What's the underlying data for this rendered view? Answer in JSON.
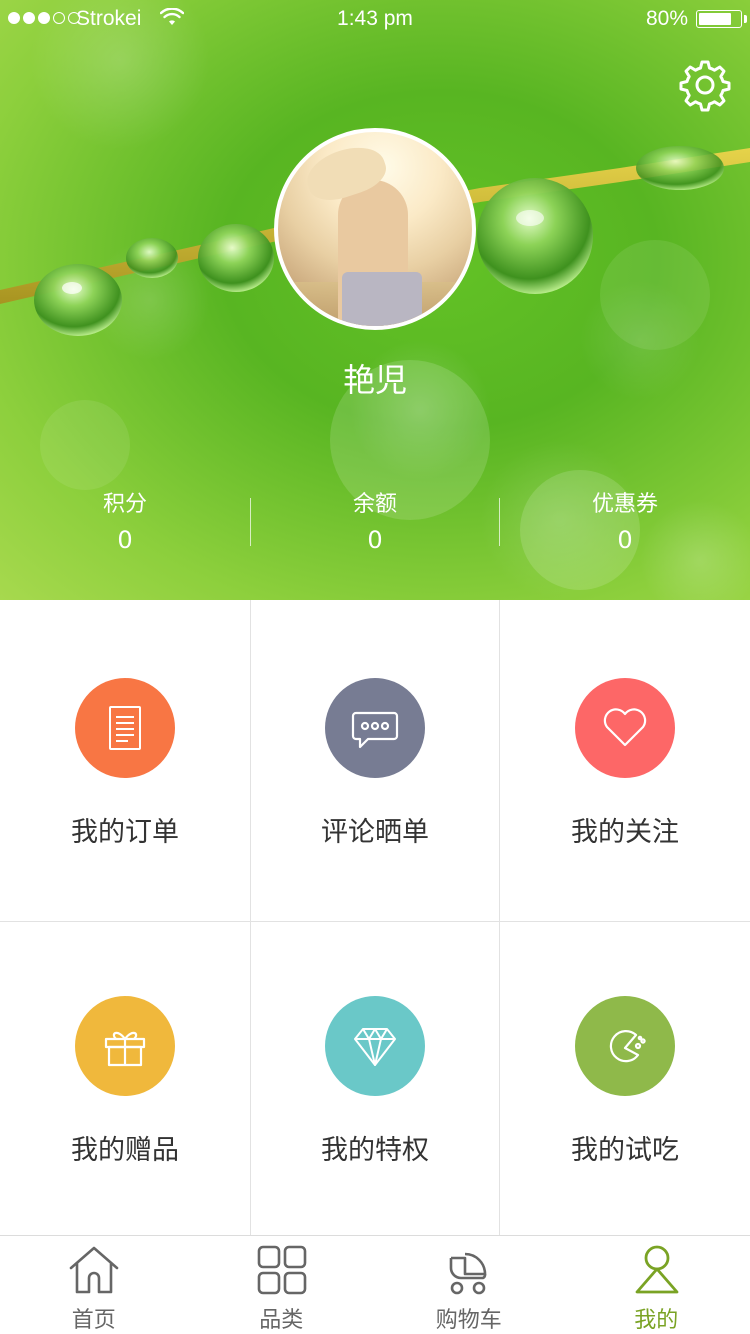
{
  "status_bar": {
    "carrier": "Strokei",
    "time": "1:43 pm",
    "battery": "80%",
    "battery_level": 0.8,
    "signal_bars_filled": 3,
    "signal_bars_total": 5
  },
  "profile": {
    "username": "艳児",
    "settings_icon": "gear-icon"
  },
  "stats": [
    {
      "label": "积分",
      "value": "0"
    },
    {
      "label": "余额",
      "value": "0"
    },
    {
      "label": "优惠券",
      "value": "0"
    }
  ],
  "menu": [
    {
      "label": "我的订单",
      "icon": "document-icon",
      "color": "#f87644"
    },
    {
      "label": "评论晒单",
      "icon": "chat-bubble-icon",
      "color": "#777c93"
    },
    {
      "label": "我的关注",
      "icon": "heart-icon",
      "color": "#fd6767"
    },
    {
      "label": "我的赠品",
      "icon": "gift-icon",
      "color": "#f0b83c"
    },
    {
      "label": "我的特权",
      "icon": "diamond-icon",
      "color": "#6ac8c8"
    },
    {
      "label": "我的试吃",
      "icon": "pacman-icon",
      "color": "#8fb94a"
    }
  ],
  "tabs": [
    {
      "label": "首页",
      "icon": "home-icon",
      "active": false
    },
    {
      "label": "品类",
      "icon": "grid-icon",
      "active": false
    },
    {
      "label": "购物车",
      "icon": "stroller-cart-icon",
      "active": false
    },
    {
      "label": "我的",
      "icon": "user-icon",
      "active": true
    }
  ],
  "colors": {
    "accent": "#7aa324",
    "tab_inactive": "#666666",
    "hero_green": "#63c226"
  }
}
